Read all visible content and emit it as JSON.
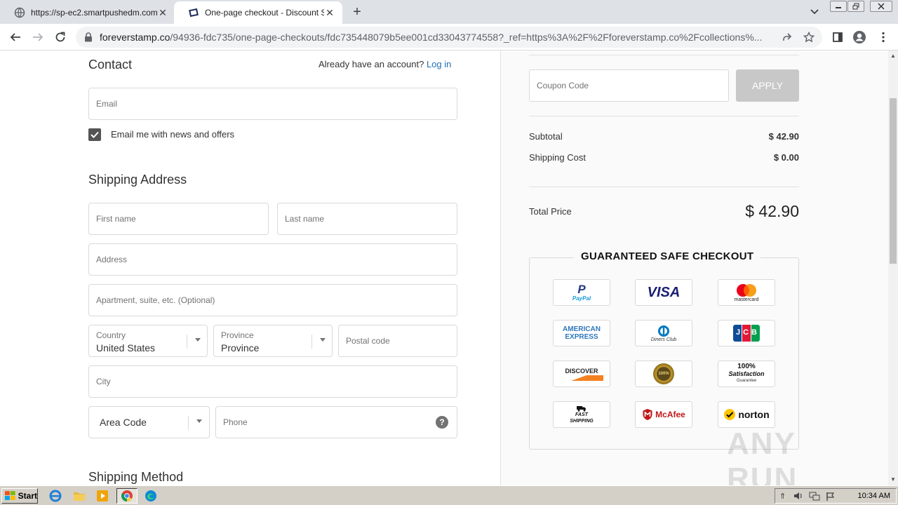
{
  "browser": {
    "tabs": [
      {
        "title": "https://sp-ec2.smartpushedm.com/a",
        "active": false
      },
      {
        "title": "One-page checkout - Discount Stamp",
        "active": true
      }
    ],
    "url_host": "foreverstamp.co",
    "url_path": "/94936-fdc735/one-page-checkouts/fdc735448079b5ee001cd33043774558?_ref=https%3A%2F%2Fforeverstamp.co%2Fcollections%..."
  },
  "contact": {
    "title": "Contact",
    "have_account": "Already have an account?",
    "login_link": "Log in",
    "email_placeholder": "Email",
    "newsletter_label": "Email me with news and offers",
    "newsletter_checked": true
  },
  "shipping_address": {
    "title": "Shipping Address",
    "first_name_placeholder": "First name",
    "last_name_placeholder": "Last name",
    "address_placeholder": "Address",
    "apartment_placeholder": "Apartment, suite, etc. (Optional)",
    "country_label": "Country",
    "country_value": "United States",
    "province_label": "Province",
    "province_value": "Province",
    "postal_placeholder": "Postal code",
    "city_placeholder": "City",
    "area_code_value": "Area Code",
    "phone_placeholder": "Phone",
    "help_icon": "?"
  },
  "shipping_method": {
    "title": "Shipping Method"
  },
  "summary": {
    "coupon_placeholder": "Coupon Code",
    "apply_label": "APPLY",
    "subtotal_label": "Subtotal",
    "subtotal_value": "$ 42.90",
    "shipping_label": "Shipping Cost",
    "shipping_value": "$ 0.00",
    "total_label": "Total Price",
    "total_value": "$ 42.90"
  },
  "trust": {
    "title": "GUARANTEED SAFE CHECKOUT",
    "badges": {
      "paypal": "PayPal",
      "visa": "VISA",
      "mastercard": "mastercard",
      "amex_1": "AMERICAN",
      "amex_2": "EXPRESS",
      "diners": "Diners Club",
      "jcb": "JCB",
      "discover": "DISCOVER",
      "money_back": "100%",
      "satisfaction_1": "100%",
      "satisfaction_2": "Satisfaction",
      "satisfaction_3": "Guarantee",
      "fast_1": "FAST",
      "fast_2": "SHIPPING",
      "mcafee": "McAfee",
      "norton": "norton"
    }
  },
  "watermark": "ANY RUN",
  "taskbar": {
    "start_label": "Start",
    "clock": "10:34 AM"
  },
  "colors": {
    "link": "#1f6fb2",
    "apply_bg": "#c8c8c8",
    "checkbox": "#545454"
  }
}
